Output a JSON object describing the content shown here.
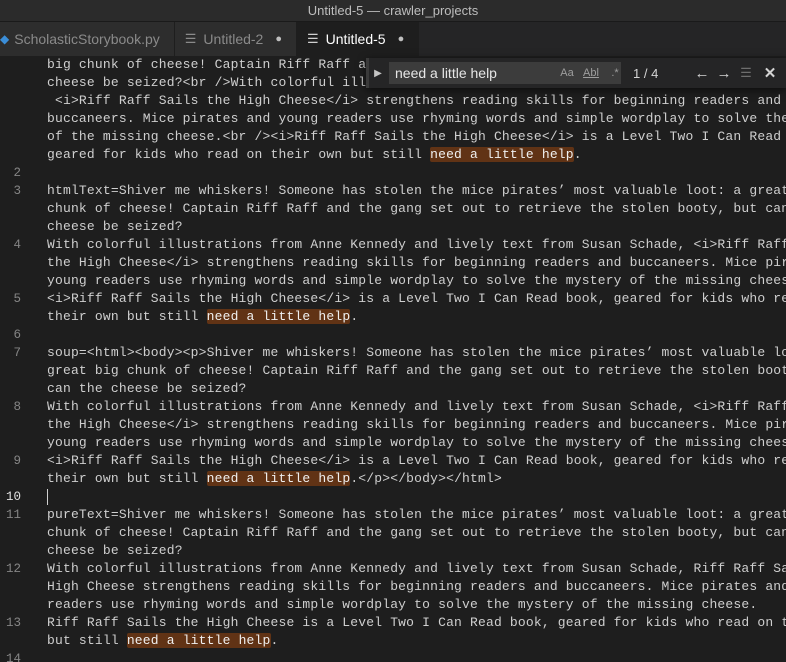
{
  "window": {
    "title": "Untitled-5 — crawler_projects"
  },
  "tabs": [
    {
      "label": "ScholasticStorybook.py",
      "icon": "python-icon",
      "active": false,
      "dirty": false
    },
    {
      "label": "Untitled-2",
      "icon": "file-lines-icon",
      "active": false,
      "dirty": true
    },
    {
      "label": "Untitled-5",
      "icon": "file-lines-icon",
      "active": true,
      "dirty": true
    }
  ],
  "find": {
    "value": "need a little help",
    "match_case_label": "Aa",
    "whole_word_label": "Abl",
    "regex_label": ".*",
    "count": "1 / 4"
  },
  "colors": {
    "highlight": "#613315",
    "background": "#1e1e1e"
  },
  "editor": {
    "current_line": "10",
    "rows": [
      {
        "ln": "",
        "segs": [
          "big chunk of cheese! Captain Riff Raff and t"
        ]
      },
      {
        "ln": "",
        "segs": [
          "cheese be seized?<br />With colorful illustr"
        ]
      },
      {
        "ln": "",
        "segs": [
          " <i>Riff Raff Sails the High Cheese</i> strengthens reading skills for beginning readers and"
        ]
      },
      {
        "ln": "",
        "segs": [
          "buccaneers. Mice pirates and young readers use rhyming words and simple wordplay to solve the mystery"
        ]
      },
      {
        "ln": "",
        "segs": [
          "of the missing cheese.<br /><i>Riff Raff Sails the High Cheese</i> is a Level Two I Can Read book,"
        ]
      },
      {
        "ln": "",
        "segs": [
          "geared for kids who read on their own but still ",
          "need a little help",
          "."
        ]
      },
      {
        "ln": "2",
        "segs": [
          ""
        ]
      },
      {
        "ln": "3",
        "segs": [
          "htmlText=Shiver me whiskers! Someone has stolen the mice pirates’ most valuable loot: a great big"
        ]
      },
      {
        "ln": "",
        "segs": [
          "chunk of cheese! Captain Riff Raff and the gang set out to retrieve the stolen booty, but can the"
        ]
      },
      {
        "ln": "",
        "segs": [
          "cheese be seized?"
        ]
      },
      {
        "ln": "4",
        "segs": [
          "With colorful illustrations from Anne Kennedy and lively text from Susan Schade, <i>Riff Raff Sails"
        ]
      },
      {
        "ln": "",
        "segs": [
          "the High Cheese</i> strengthens reading skills for beginning readers and buccaneers. Mice pirates and"
        ]
      },
      {
        "ln": "",
        "segs": [
          "young readers use rhyming words and simple wordplay to solve the mystery of the missing cheese."
        ]
      },
      {
        "ln": "5",
        "segs": [
          "<i>Riff Raff Sails the High Cheese</i> is a Level Two I Can Read book, geared for kids who read on"
        ]
      },
      {
        "ln": "",
        "segs": [
          "their own but still ",
          "need a little help",
          "."
        ]
      },
      {
        "ln": "6",
        "segs": [
          ""
        ]
      },
      {
        "ln": "7",
        "segs": [
          "soup=<html><body><p>Shiver me whiskers! Someone has stolen the mice pirates’ most valuable loot: a"
        ]
      },
      {
        "ln": "",
        "segs": [
          "great big chunk of cheese! Captain Riff Raff and the gang set out to retrieve the stolen booty, but"
        ]
      },
      {
        "ln": "",
        "segs": [
          "can the cheese be seized?"
        ]
      },
      {
        "ln": "8",
        "segs": [
          "With colorful illustrations from Anne Kennedy and lively text from Susan Schade, <i>Riff Raff Sails"
        ]
      },
      {
        "ln": "",
        "segs": [
          "the High Cheese</i> strengthens reading skills for beginning readers and buccaneers. Mice pirates and"
        ]
      },
      {
        "ln": "",
        "segs": [
          "young readers use rhyming words and simple wordplay to solve the mystery of the missing cheese."
        ]
      },
      {
        "ln": "9",
        "segs": [
          "<i>Riff Raff Sails the High Cheese</i> is a Level Two I Can Read book, geared for kids who read on"
        ]
      },
      {
        "ln": "",
        "segs": [
          "their own but still ",
          "need a little help",
          ".</p></body></html>"
        ]
      },
      {
        "ln": "10",
        "segs": [
          ""
        ]
      },
      {
        "ln": "11",
        "segs": [
          "pureText=Shiver me whiskers! Someone has stolen the mice pirates’ most valuable loot: a great big"
        ]
      },
      {
        "ln": "",
        "segs": [
          "chunk of cheese! Captain Riff Raff and the gang set out to retrieve the stolen booty, but can the"
        ]
      },
      {
        "ln": "",
        "segs": [
          "cheese be seized?"
        ]
      },
      {
        "ln": "12",
        "segs": [
          "With colorful illustrations from Anne Kennedy and lively text from Susan Schade, Riff Raff Sails the"
        ]
      },
      {
        "ln": "",
        "segs": [
          "High Cheese strengthens reading skills for beginning readers and buccaneers. Mice pirates and young"
        ]
      },
      {
        "ln": "",
        "segs": [
          "readers use rhyming words and simple wordplay to solve the mystery of the missing cheese."
        ]
      },
      {
        "ln": "13",
        "segs": [
          "Riff Raff Sails the High Cheese is a Level Two I Can Read book, geared for kids who read on their own"
        ]
      },
      {
        "ln": "",
        "segs": [
          "but still ",
          "need a little help",
          "."
        ]
      },
      {
        "ln": "14",
        "segs": [
          ""
        ]
      }
    ]
  }
}
